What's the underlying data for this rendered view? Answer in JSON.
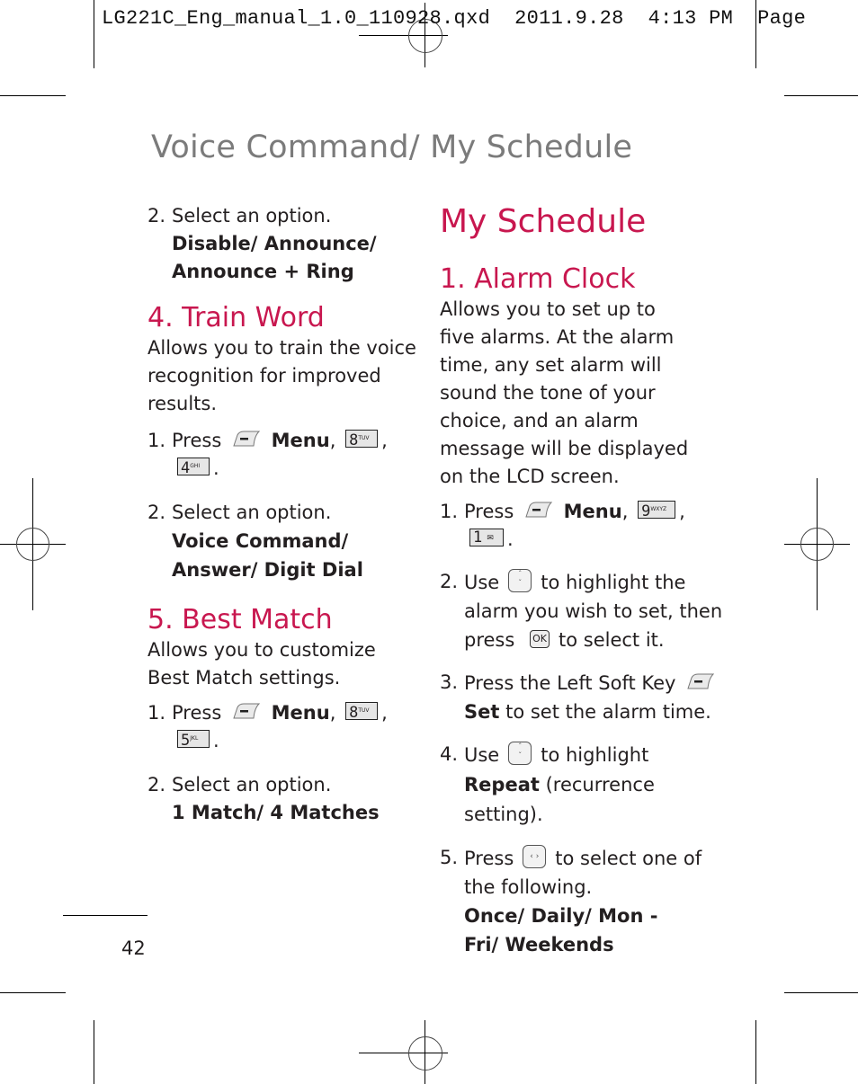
{
  "print_slug": "LG221C_Eng_manual_1.0_110928.qxd  2011.9.28  4:13 PM  Page",
  "running_title": "Voice Command/ My Schedule",
  "page_number": "42",
  "accent_color": "#c8174f",
  "left_column": {
    "intro_step": {
      "num": "2.",
      "text": "Select an option.",
      "options": "Disable/ Announce/ Announce + Ring"
    },
    "train_word": {
      "heading": "4. Train Word",
      "description": "Allows you to train the voice recognition for improved results.",
      "step1": {
        "num": "1.",
        "press": "Press",
        "menu": "Menu",
        "key1_digit": "8",
        "key1_letters": "TUV",
        "key2_digit": "4",
        "key2_letters": "GHI"
      },
      "step2": {
        "num": "2.",
        "text": "Select an option.",
        "options": "Voice Command/ Answer/ Digit Dial"
      }
    },
    "best_match": {
      "heading": "5. Best Match",
      "description": "Allows you to customize Best Match settings.",
      "step1": {
        "num": "1.",
        "press": "Press",
        "menu": "Menu",
        "key1_digit": "8",
        "key1_letters": "TUV",
        "key2_digit": "5",
        "key2_letters": "JKL"
      },
      "step2": {
        "num": "2.",
        "text": "Select an option.",
        "options": "1 Match/ 4 Matches"
      }
    }
  },
  "right_column": {
    "heading": "My Schedule",
    "alarm_clock": {
      "heading": "1. Alarm Clock",
      "description": "Allows you to set up to five alarms. At the alarm time, any set alarm will sound the tone of your choice, and an alarm message will be displayed on the LCD screen.",
      "step1": {
        "num": "1.",
        "press": "Press",
        "menu": "Menu",
        "key1_digit": "9",
        "key1_letters": "WXYZ",
        "key2_digit": "1"
      },
      "step2": {
        "num": "2.",
        "use": "Use",
        "text_a": "to highlight the alarm you wish to set, then press",
        "ok": "OK",
        "text_b": "to select it."
      },
      "step3": {
        "num": "3.",
        "text_a": "Press the Left Soft Key",
        "set": "Set",
        "text_b": "to set the alarm time."
      },
      "step4": {
        "num": "4.",
        "use": "Use",
        "text_a": "to highlight",
        "repeat": "Repeat",
        "text_b": "(recurrence setting)."
      },
      "step5": {
        "num": "5.",
        "press": "Press",
        "text_a": "to select one of the following.",
        "options": "Once/ Daily/ Mon - Fri/ Weekends"
      }
    }
  }
}
